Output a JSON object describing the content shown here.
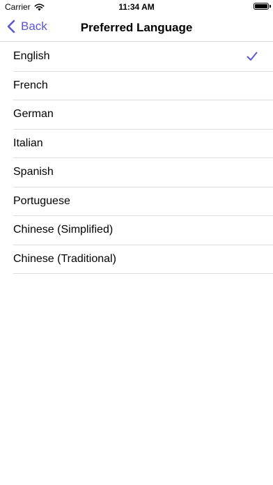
{
  "status_bar": {
    "carrier": "Carrier",
    "time": "11:34 AM",
    "wifi_icon": "wifi-icon",
    "battery_icon": "battery-icon"
  },
  "nav": {
    "back_label": "Back",
    "back_icon": "chevron-left-icon",
    "title": "Preferred Language",
    "accent_color": "#5b57d1"
  },
  "languages": [
    {
      "label": "English",
      "selected": true
    },
    {
      "label": "French",
      "selected": false
    },
    {
      "label": "German",
      "selected": false
    },
    {
      "label": "Italian",
      "selected": false
    },
    {
      "label": "Spanish",
      "selected": false
    },
    {
      "label": "Portuguese",
      "selected": false
    },
    {
      "label": "Chinese (Simplified)",
      "selected": false
    },
    {
      "label": "Chinese (Traditional)",
      "selected": false
    }
  ],
  "selection_icon": "checkmark-icon"
}
